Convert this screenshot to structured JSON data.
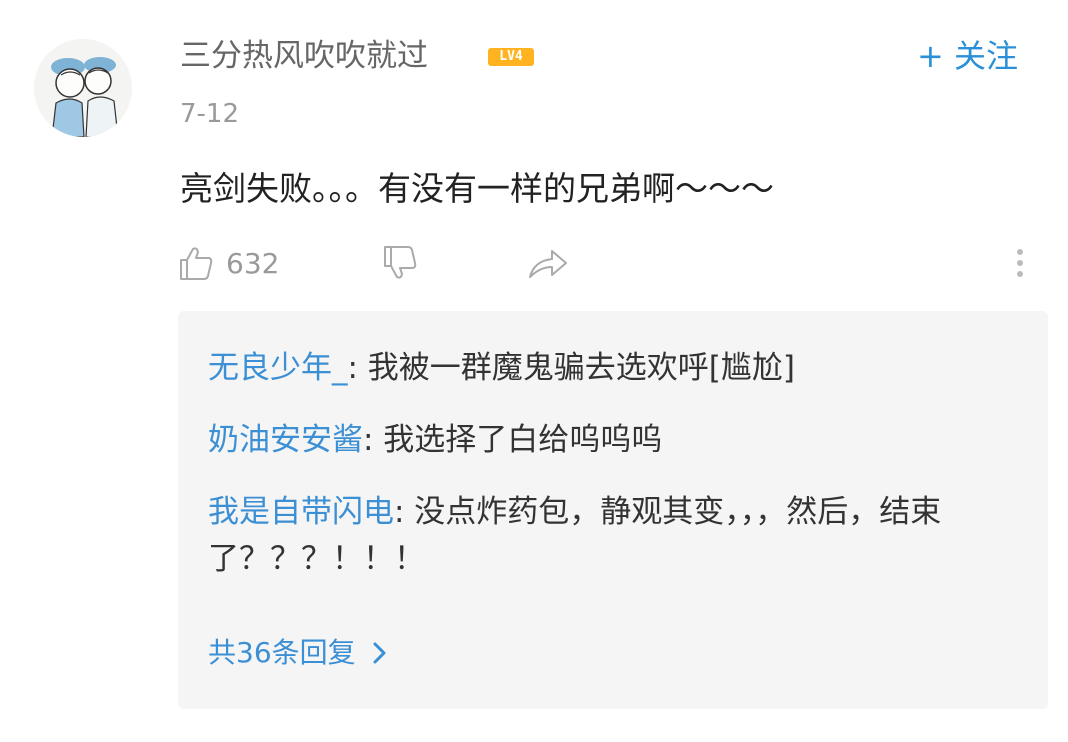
{
  "comment": {
    "username": "三分热风吹吹就过",
    "level_badge": "LV4",
    "follow_label": "+ 关注",
    "date": "7-12",
    "text": "亮剑失败。。。有没有一样的兄弟啊～～～",
    "like_count": "632"
  },
  "replies": [
    {
      "name": "无良少年_",
      "text": ": 我被一群魔鬼骗去选欢呼[尴尬]"
    },
    {
      "name": "奶油安安酱",
      "text": ": 我选择了白给呜呜呜"
    },
    {
      "name": "我是自带闪电",
      "text": ": 没点炸药包，静观其变，，，然后，结束了？？？！！！"
    }
  ],
  "more_replies_label": "共36条回复",
  "colors": {
    "link": "#3b8fd4",
    "follow": "#2a90d7",
    "badge": "#ffb320",
    "reply_bg": "#f5f5f5",
    "muted": "#999999"
  },
  "icons": {
    "like": "thumbs-up-icon",
    "dislike": "thumbs-down-icon",
    "share": "share-arrow-icon",
    "more": "more-vertical-icon",
    "chevron": "chevron-right-icon"
  }
}
